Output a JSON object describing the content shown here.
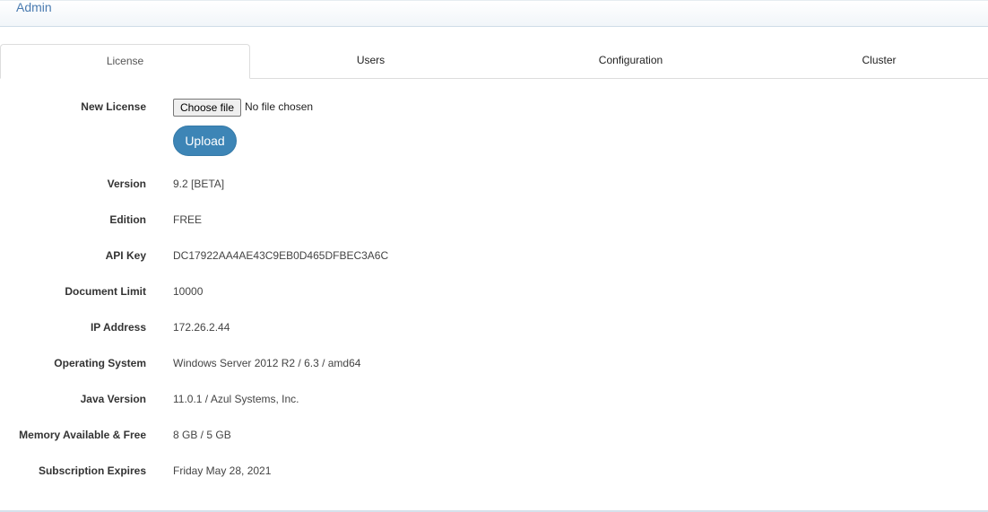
{
  "header": {
    "title": "Admin"
  },
  "tabs": [
    {
      "label": "License",
      "active": true
    },
    {
      "label": "Users",
      "active": false
    },
    {
      "label": "Configuration",
      "active": false
    },
    {
      "label": "Cluster",
      "active": false
    }
  ],
  "license": {
    "new_license_label": "New License",
    "choose_file_label": "Choose file",
    "file_status": "No file chosen",
    "upload_label": "Upload",
    "rows": [
      {
        "label": "Version",
        "value": "9.2 [BETA]"
      },
      {
        "label": "Edition",
        "value": "FREE"
      },
      {
        "label": "API Key",
        "value": "DC17922AA4AE43C9EB0D465DFBEC3A6C"
      },
      {
        "label": "Document Limit",
        "value": "10000"
      },
      {
        "label": "IP Address",
        "value": "172.26.2.44"
      },
      {
        "label": "Operating System",
        "value": "Windows Server 2012 R2 / 6.3 / amd64"
      },
      {
        "label": "Java Version",
        "value": "11.0.1 / Azul Systems, Inc."
      },
      {
        "label": "Memory Available & Free",
        "value": "8 GB / 5 GB"
      },
      {
        "label": "Subscription Expires",
        "value": "Friday May 28, 2021"
      }
    ]
  },
  "colors": {
    "accent": "#3d85b6",
    "header_title": "#4a7bb0"
  }
}
